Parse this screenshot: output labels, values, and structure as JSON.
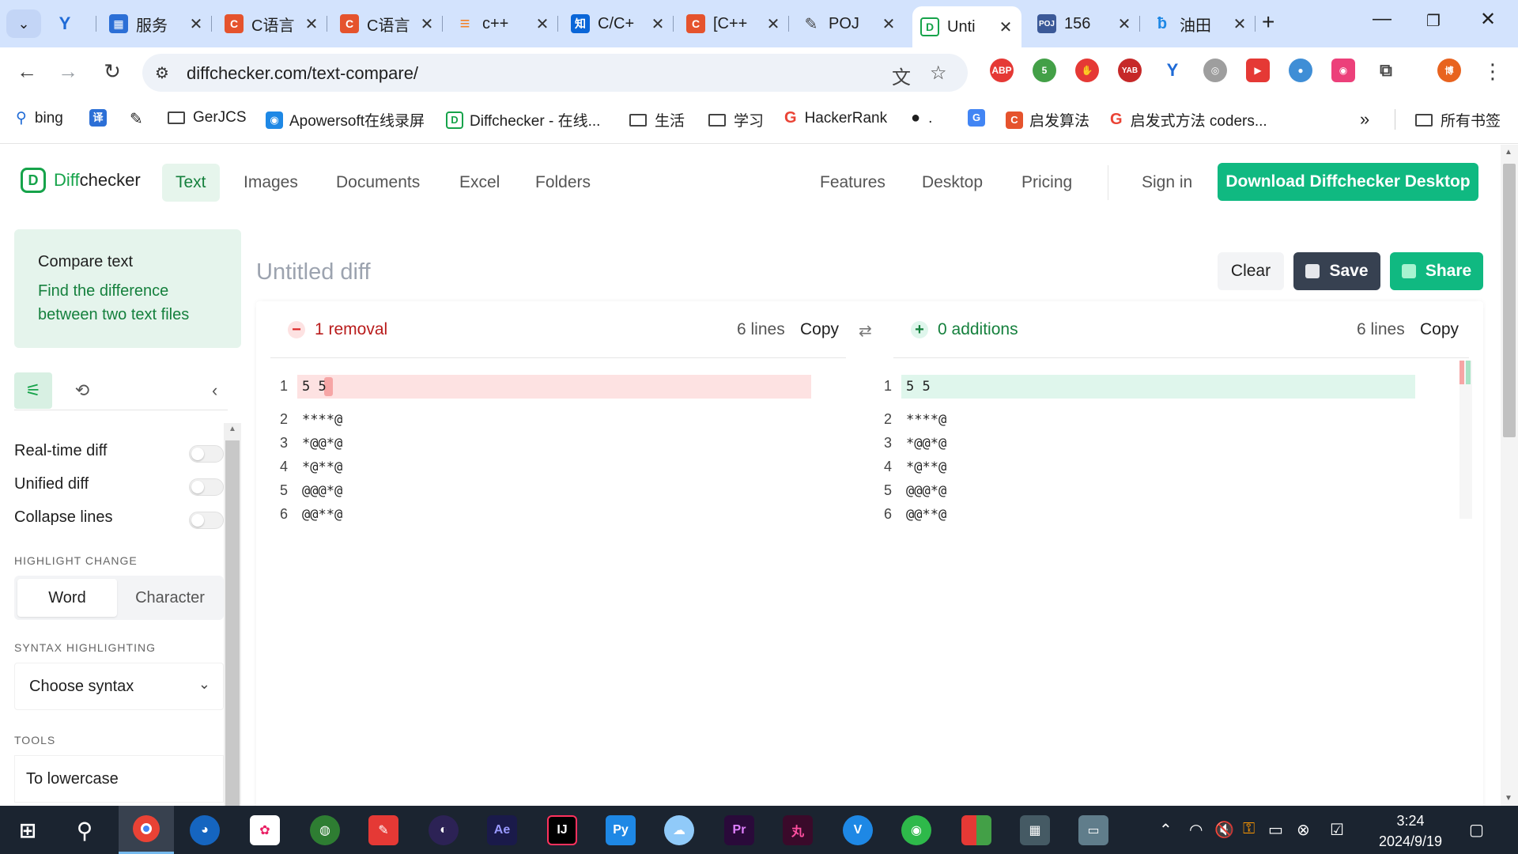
{
  "browser": {
    "tabs": [
      {
        "title": "服务",
        "favicon": "cms-icon",
        "color": "#2c6fd6",
        "glyph": "▦"
      },
      {
        "title": "C语言",
        "favicon": "csdn-icon",
        "color": "#e5532d",
        "glyph": "C"
      },
      {
        "title": "C语言",
        "favicon": "csdn-icon",
        "color": "#e5532d",
        "glyph": "C"
      },
      {
        "title": "c++",
        "favicon": "stackoverflow-icon",
        "color": "#f48024",
        "glyph": "≡"
      },
      {
        "title": "C/C+",
        "favicon": "zhihu-icon",
        "color": "#0a66d8",
        "glyph": "知"
      },
      {
        "title": "[C++",
        "favicon": "csdn-icon",
        "color": "#e5532d",
        "glyph": "C"
      },
      {
        "title": "POJ",
        "favicon": "poj-icon",
        "color": "#555555",
        "glyph": "✎"
      },
      {
        "title": "Unti",
        "favicon": "diffchecker-icon",
        "color": "#16a34a",
        "glyph": "D"
      },
      {
        "title": "156",
        "favicon": "poj-logo-icon",
        "color": "#3b5998",
        "glyph": "P"
      },
      {
        "title": "油田",
        "favicon": "bilibili-icon",
        "color": "#1e88e5",
        "glyph": "ƀ"
      }
    ],
    "url": "diffchecker.com/text-compare/",
    "extension_badge": "5",
    "bookmarks": [
      {
        "label": "bing"
      },
      {
        "label": "GerJCS"
      },
      {
        "label": "Apowersoft在线录屏"
      },
      {
        "label": "Diffchecker - 在线..."
      },
      {
        "label": "生活"
      },
      {
        "label": "学习"
      },
      {
        "label": "HackerRank"
      },
      {
        "label": "."
      },
      {
        "label": "启发算法"
      },
      {
        "label": "启发式方法 coders..."
      },
      {
        "label": "所有书签"
      }
    ]
  },
  "site": {
    "brand_part1": "Diff",
    "brand_part2": "checker",
    "nav": [
      "Text",
      "Images",
      "Documents",
      "Excel",
      "Folders"
    ],
    "right_nav": [
      "Features",
      "Desktop",
      "Pricing"
    ],
    "sign_in": "Sign in",
    "download": "Download Diffchecker Desktop",
    "accent": "#10b981"
  },
  "sidebar": {
    "card_title": "Compare text",
    "card_desc": "Find the difference between two text files",
    "options": [
      "Real-time diff",
      "Unified diff",
      "Collapse lines"
    ],
    "highlight_heading": "HIGHLIGHT CHANGE",
    "highlight_options": [
      "Word",
      "Character"
    ],
    "syntax_heading": "SYNTAX HIGHLIGHTING",
    "syntax_value": "Choose syntax",
    "tools_heading": "TOOLS",
    "tool_first": "To lowercase"
  },
  "diff": {
    "title": "Untitled diff",
    "buttons": {
      "clear": "Clear",
      "save": "Save",
      "share": "Share"
    },
    "left": {
      "summary": "1 removal",
      "line_count": "6 lines",
      "copy": "Copy",
      "lines": [
        "5 5",
        "****@",
        "*@@*@",
        "*@**@",
        "@@@*@",
        "@@**@"
      ]
    },
    "right": {
      "summary": "0 additions",
      "line_count": "6 lines",
      "copy": "Copy",
      "lines": [
        "5 5",
        "****@",
        "*@@*@",
        "*@**@",
        "@@@*@",
        "@@**@"
      ]
    },
    "removal_color": "#dc2626",
    "addition_color": "#15803d"
  },
  "taskbar": {
    "time": "3:24",
    "date": "2024/9/19"
  }
}
